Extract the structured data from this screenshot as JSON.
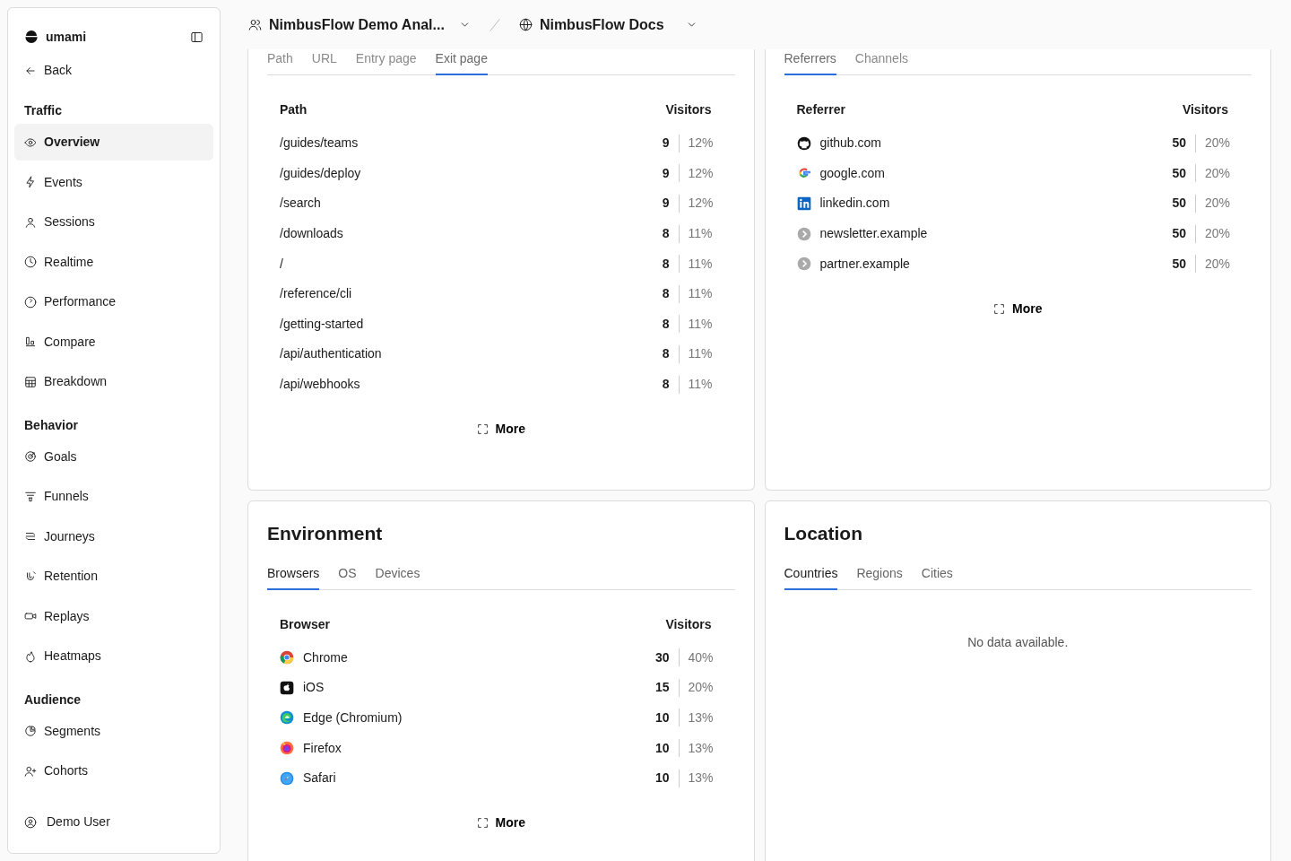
{
  "sidebar": {
    "brand": "umami",
    "back": "Back",
    "sections": [
      {
        "title": "Traffic",
        "items": [
          {
            "label": "Overview",
            "selected": true
          },
          {
            "label": "Events",
            "selected": false
          },
          {
            "label": "Sessions",
            "selected": false
          },
          {
            "label": "Realtime",
            "selected": false
          },
          {
            "label": "Performance",
            "selected": false
          },
          {
            "label": "Compare",
            "selected": false
          },
          {
            "label": "Breakdown",
            "selected": false
          }
        ]
      },
      {
        "title": "Behavior",
        "items": [
          {
            "label": "Goals",
            "selected": false
          },
          {
            "label": "Funnels",
            "selected": false
          },
          {
            "label": "Journeys",
            "selected": false
          },
          {
            "label": "Retention",
            "selected": false
          },
          {
            "label": "Replays",
            "selected": false
          },
          {
            "label": "Heatmaps",
            "selected": false
          }
        ]
      },
      {
        "title": "Audience",
        "items": [
          {
            "label": "Segments",
            "selected": false
          },
          {
            "label": "Cohorts",
            "selected": false
          }
        ]
      }
    ],
    "user": "Demo User"
  },
  "header": {
    "team": "NimbusFlow Demo Anal...",
    "website": "NimbusFlow Docs"
  },
  "panels": [
    {
      "tabs": [
        {
          "label": "Path",
          "selected": false
        },
        {
          "label": "URL",
          "selected": false
        },
        {
          "label": "Entry page",
          "selected": false
        },
        {
          "label": "Exit page",
          "selected": true
        }
      ],
      "columns": [
        "Path",
        "Visitors"
      ],
      "rows": [
        {
          "label": "/guides/teams",
          "visitors": "9",
          "percent": "12%"
        },
        {
          "label": "/guides/deploy",
          "visitors": "9",
          "percent": "12%"
        },
        {
          "label": "/search",
          "visitors": "9",
          "percent": "12%"
        },
        {
          "label": "/downloads",
          "visitors": "8",
          "percent": "11%"
        },
        {
          "label": "/",
          "visitors": "8",
          "percent": "11%"
        },
        {
          "label": "/reference/cli",
          "visitors": "8",
          "percent": "11%"
        },
        {
          "label": "/getting-started",
          "visitors": "8",
          "percent": "11%"
        },
        {
          "label": "/api/authentication",
          "visitors": "8",
          "percent": "11%"
        },
        {
          "label": "/api/webhooks",
          "visitors": "8",
          "percent": "11%"
        }
      ],
      "more": "More"
    },
    {
      "tabs": [
        {
          "label": "Referrers",
          "selected": true
        },
        {
          "label": "Channels",
          "selected": false
        }
      ],
      "columns": [
        "Referrer",
        "Visitors"
      ],
      "rows": [
        {
          "label": "github.com",
          "visitors": "50",
          "percent": "20%"
        },
        {
          "label": "google.com",
          "visitors": "50",
          "percent": "20%"
        },
        {
          "label": "linkedin.com",
          "visitors": "50",
          "percent": "20%"
        },
        {
          "label": "newsletter.example",
          "visitors": "50",
          "percent": "20%"
        },
        {
          "label": "partner.example",
          "visitors": "50",
          "percent": "20%"
        }
      ],
      "more": "More"
    },
    {
      "title": "Environment",
      "tabs": [
        {
          "label": "Browsers",
          "selected": true
        },
        {
          "label": "OS",
          "selected": false
        },
        {
          "label": "Devices",
          "selected": false
        }
      ],
      "columns": [
        "Browser",
        "Visitors"
      ],
      "rows": [
        {
          "label": "Chrome",
          "visitors": "30",
          "percent": "40%"
        },
        {
          "label": "iOS",
          "visitors": "15",
          "percent": "20%"
        },
        {
          "label": "Edge (Chromium)",
          "visitors": "10",
          "percent": "13%"
        },
        {
          "label": "Firefox",
          "visitors": "10",
          "percent": "13%"
        },
        {
          "label": "Safari",
          "visitors": "10",
          "percent": "13%"
        }
      ],
      "more": "More"
    },
    {
      "title": "Location",
      "tabs": [
        {
          "label": "Countries",
          "selected": true
        },
        {
          "label": "Regions",
          "selected": false
        },
        {
          "label": "Cities",
          "selected": false
        }
      ],
      "empty": "No data available."
    }
  ]
}
